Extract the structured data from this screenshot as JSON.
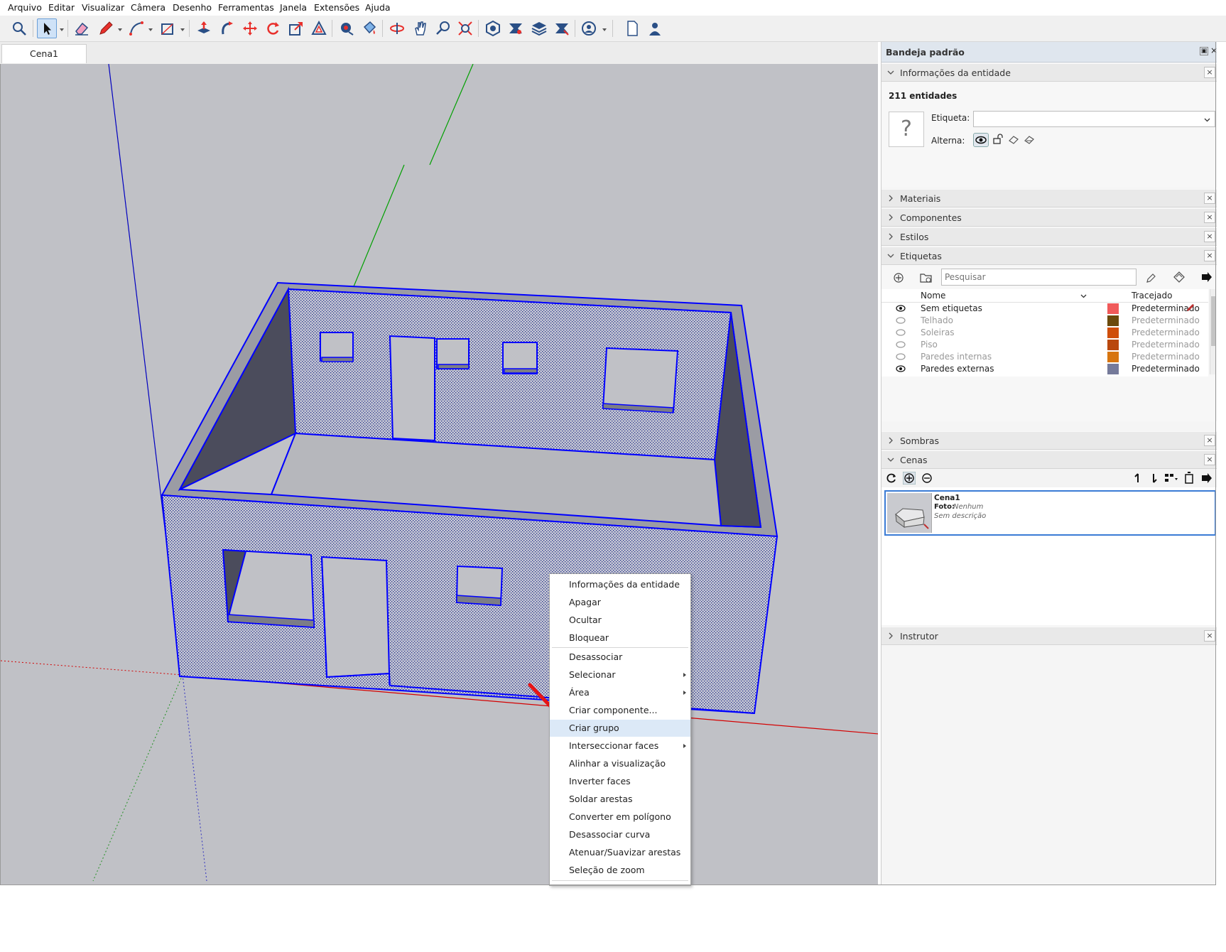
{
  "menubar": [
    "Arquivo",
    "Editar",
    "Visualizar",
    "Câmera",
    "Desenho",
    "Ferramentas",
    "Janela",
    "Extensões",
    "Ajuda"
  ],
  "scene_tab": "Cena1",
  "context_menu": {
    "items": [
      {
        "label": "Informações da entidade",
        "submenu": false
      },
      {
        "label": "Apagar",
        "submenu": false
      },
      {
        "label": "Ocultar",
        "submenu": false
      },
      {
        "label": "Bloquear",
        "submenu": false
      },
      {
        "label": "Desassociar",
        "submenu": false
      },
      {
        "label": "Selecionar",
        "submenu": true
      },
      {
        "label": "Área",
        "submenu": true
      },
      {
        "label": "Criar componente...",
        "submenu": false
      },
      {
        "label": "Criar grupo",
        "submenu": false,
        "highlighted": true
      },
      {
        "label": "Interseccionar faces",
        "submenu": true
      },
      {
        "label": "Alinhar a visualização",
        "submenu": false
      },
      {
        "label": "Inverter faces",
        "submenu": false
      },
      {
        "label": "Soldar arestas",
        "submenu": false
      },
      {
        "label": "Converter em polígono",
        "submenu": false
      },
      {
        "label": "Desassociar curva",
        "submenu": false
      },
      {
        "label": "Atenuar/Suavizar arestas",
        "submenu": false
      },
      {
        "label": "Seleção de zoom",
        "submenu": false
      }
    ]
  },
  "tray": {
    "title": "Bandeja padrão",
    "entity_info": {
      "header": "Informações da entidade",
      "count": "211 entidades",
      "tag_label": "Etiqueta:",
      "toggle_label": "Alterna:",
      "preview_glyph": "?"
    },
    "panels": {
      "materials": "Materiais",
      "components": "Componentes",
      "styles": "Estilos",
      "tags": "Etiquetas",
      "shadows": "Sombras",
      "scenes": "Cenas",
      "instructor": "Instrutor"
    },
    "tags_panel": {
      "search_placeholder": "Pesquisar",
      "col_name": "Nome",
      "col_dash": "Tracejado",
      "rows": [
        {
          "name": "Sem etiquetas",
          "visible": true,
          "color": "#f05a5a",
          "dash": "Predeterminado"
        },
        {
          "name": "Telhado",
          "visible": false,
          "color": "#6b4a0c",
          "dash": "Predeterminado"
        },
        {
          "name": "Soleiras",
          "visible": false,
          "color": "#cf4e0a",
          "dash": "Predeterminado"
        },
        {
          "name": "Piso",
          "visible": false,
          "color": "#b9480d",
          "dash": "Predeterminado"
        },
        {
          "name": "Paredes internas",
          "visible": false,
          "color": "#d7750f",
          "dash": "Predeterminado"
        },
        {
          "name": "Paredes externas",
          "visible": true,
          "color": "#757a9a",
          "dash": "Predeterminado"
        }
      ]
    },
    "scenes_panel": {
      "scene_name": "Cena1",
      "photo_label": "Foto:",
      "photo_value": "Nenhum",
      "description": "Sem descrição"
    }
  },
  "colors": {
    "selection": "#0000ff",
    "viewport": "#c0c1c6",
    "axis_red": "#d40000",
    "axis_green": "#00a000",
    "axis_blue": "#0000c0",
    "annotation_arrow": "#e81414"
  }
}
